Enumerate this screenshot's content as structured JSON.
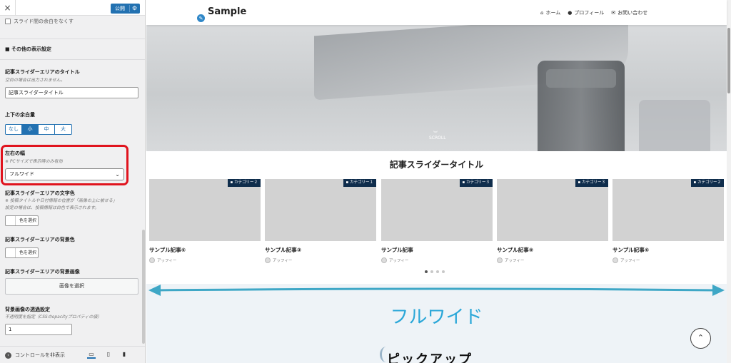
{
  "panel": {
    "close_label": "×",
    "publish_label": "公開",
    "publish_icon": "gear-icon",
    "checkbox_label": "スライド間の余白をなくす",
    "section_heading": "■ その他の表示設定",
    "title_field": {
      "label": "記事スライダーエリアのタイトル",
      "description": "空白の場合は出力されません。",
      "value": "記事スライダータイトル"
    },
    "spacing": {
      "label": "上下の余白量",
      "options": [
        "なし",
        "小",
        "中",
        "大"
      ],
      "selected": "小"
    },
    "width": {
      "label": "左右の幅",
      "description": "※ PCサイズで表示時のみ有効",
      "value": "フルワイド"
    },
    "text_color": {
      "label": "記事スライダーエリアの文字色",
      "description_1": "※ 投稿タイトルや日付情報の位置が「画像の上に被せる」",
      "description_2": "設定の場合は、投稿情報は白色で表示されます。",
      "button": "色を選択"
    },
    "bg_color": {
      "label": "記事スライダーエリアの背景色",
      "button": "色を選択"
    },
    "bg_image": {
      "label": "記事スライダーエリアの背景画像",
      "button": "画像を選択"
    },
    "opacity": {
      "label": "背景画像の透過設定",
      "description": "不透明度を指定（CSSのopacityプロパティの値）",
      "value": "1"
    },
    "footer": {
      "hide_controls": "コントロールを非表示",
      "devices": [
        "desktop-icon",
        "tablet-icon",
        "mobile-icon"
      ]
    }
  },
  "preview": {
    "site_title": "Sample",
    "nav": [
      {
        "icon": "home-icon",
        "label": "ホーム"
      },
      {
        "icon": "person-icon",
        "label": "プロフィール"
      },
      {
        "icon": "mail-icon",
        "label": "お問い合わせ"
      }
    ],
    "scroll_hint": "SCROLL",
    "slider_title": "記事スライダータイトル",
    "cards": [
      {
        "category": "カテゴリー２",
        "title": "サンプル記事⑥",
        "author": "アッフィー"
      },
      {
        "category": "カテゴリー１",
        "title": "サンプル記事③",
        "author": "アッフィー"
      },
      {
        "category": "カテゴリー３",
        "title": "サンプル記事",
        "author": "アッフィー"
      },
      {
        "category": "カテゴリー３",
        "title": "サンプル記事⑨",
        "author": "アッフィー"
      },
      {
        "category": "カテゴリー２",
        "title": "サンプル記事⑥",
        "author": "アッフィー"
      }
    ],
    "pagination": {
      "count": 4,
      "active": 1
    },
    "annotation": "フルワイド",
    "annotation_color": "#2aa7d8",
    "next_section_heading": "ピックアップ"
  },
  "colors": {
    "accent": "#2271b1",
    "highlight_box": "#e0141e",
    "category_badge": "#0f2d4c"
  }
}
